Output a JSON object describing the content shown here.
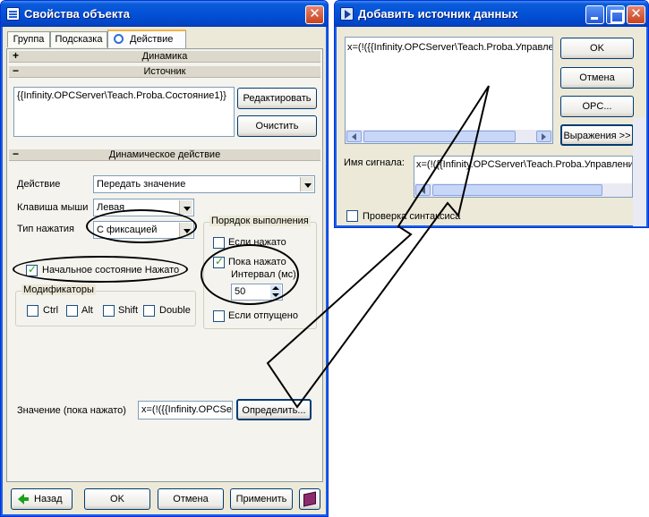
{
  "left_window": {
    "title": "Свойства объекта",
    "tabs": [
      "Группа",
      "Подсказка",
      "Действие"
    ],
    "sections": {
      "dynamics": "Динамика",
      "source": "Источник",
      "dynamic_action": "Динамическое действие"
    },
    "source_text": "{{Infinity.OPCServer\\Teach.Proba.Состояние1}}",
    "edit_button": "Редактировать",
    "clear_button": "Очистить",
    "action_label": "Действие",
    "action_value": "Передать значение",
    "mouse_key_label": "Клавиша мыши",
    "mouse_key_value": "Левая",
    "press_type_label": "Тип нажатия",
    "press_type_value": "С фиксацией",
    "initial_state_label": "Начальное состояние Нажато",
    "modifiers_label": "Модификаторы",
    "modifiers": [
      "Ctrl",
      "Alt",
      "Shift",
      "Double"
    ],
    "order_label": "Порядок выполнения",
    "if_pressed": "Если нажато",
    "while_pressed": "Пока нажато",
    "interval_label": "Интервал (мс)",
    "interval_value": "50",
    "if_released": "Если отпущено",
    "value_label": "Значение (пока нажато)",
    "value_text": "x=(!({{Infinity.OPCServ",
    "define_button": "Определить...",
    "back_button": "Назад",
    "ok_button": "OK",
    "cancel_button": "Отмена",
    "apply_button": "Применить"
  },
  "right_window": {
    "title": "Добавить источник данных",
    "expression_text": "x=(!({{Infinity.OPCServer\\Teach.Proba.Управле",
    "ok_button": "OK",
    "cancel_button": "Отмена",
    "opc_button": "OPC...",
    "expressions_button": "Выражения >>",
    "signal_label": "Имя сигнала:",
    "signal_text": "x=(!({{Infinity.OPCServer\\Teach.Proba.Управлени",
    "syntax_check": "Проверка синтаксиса"
  },
  "icons": {
    "back": "green-arrow-left-icon",
    "help": "book-icon"
  }
}
